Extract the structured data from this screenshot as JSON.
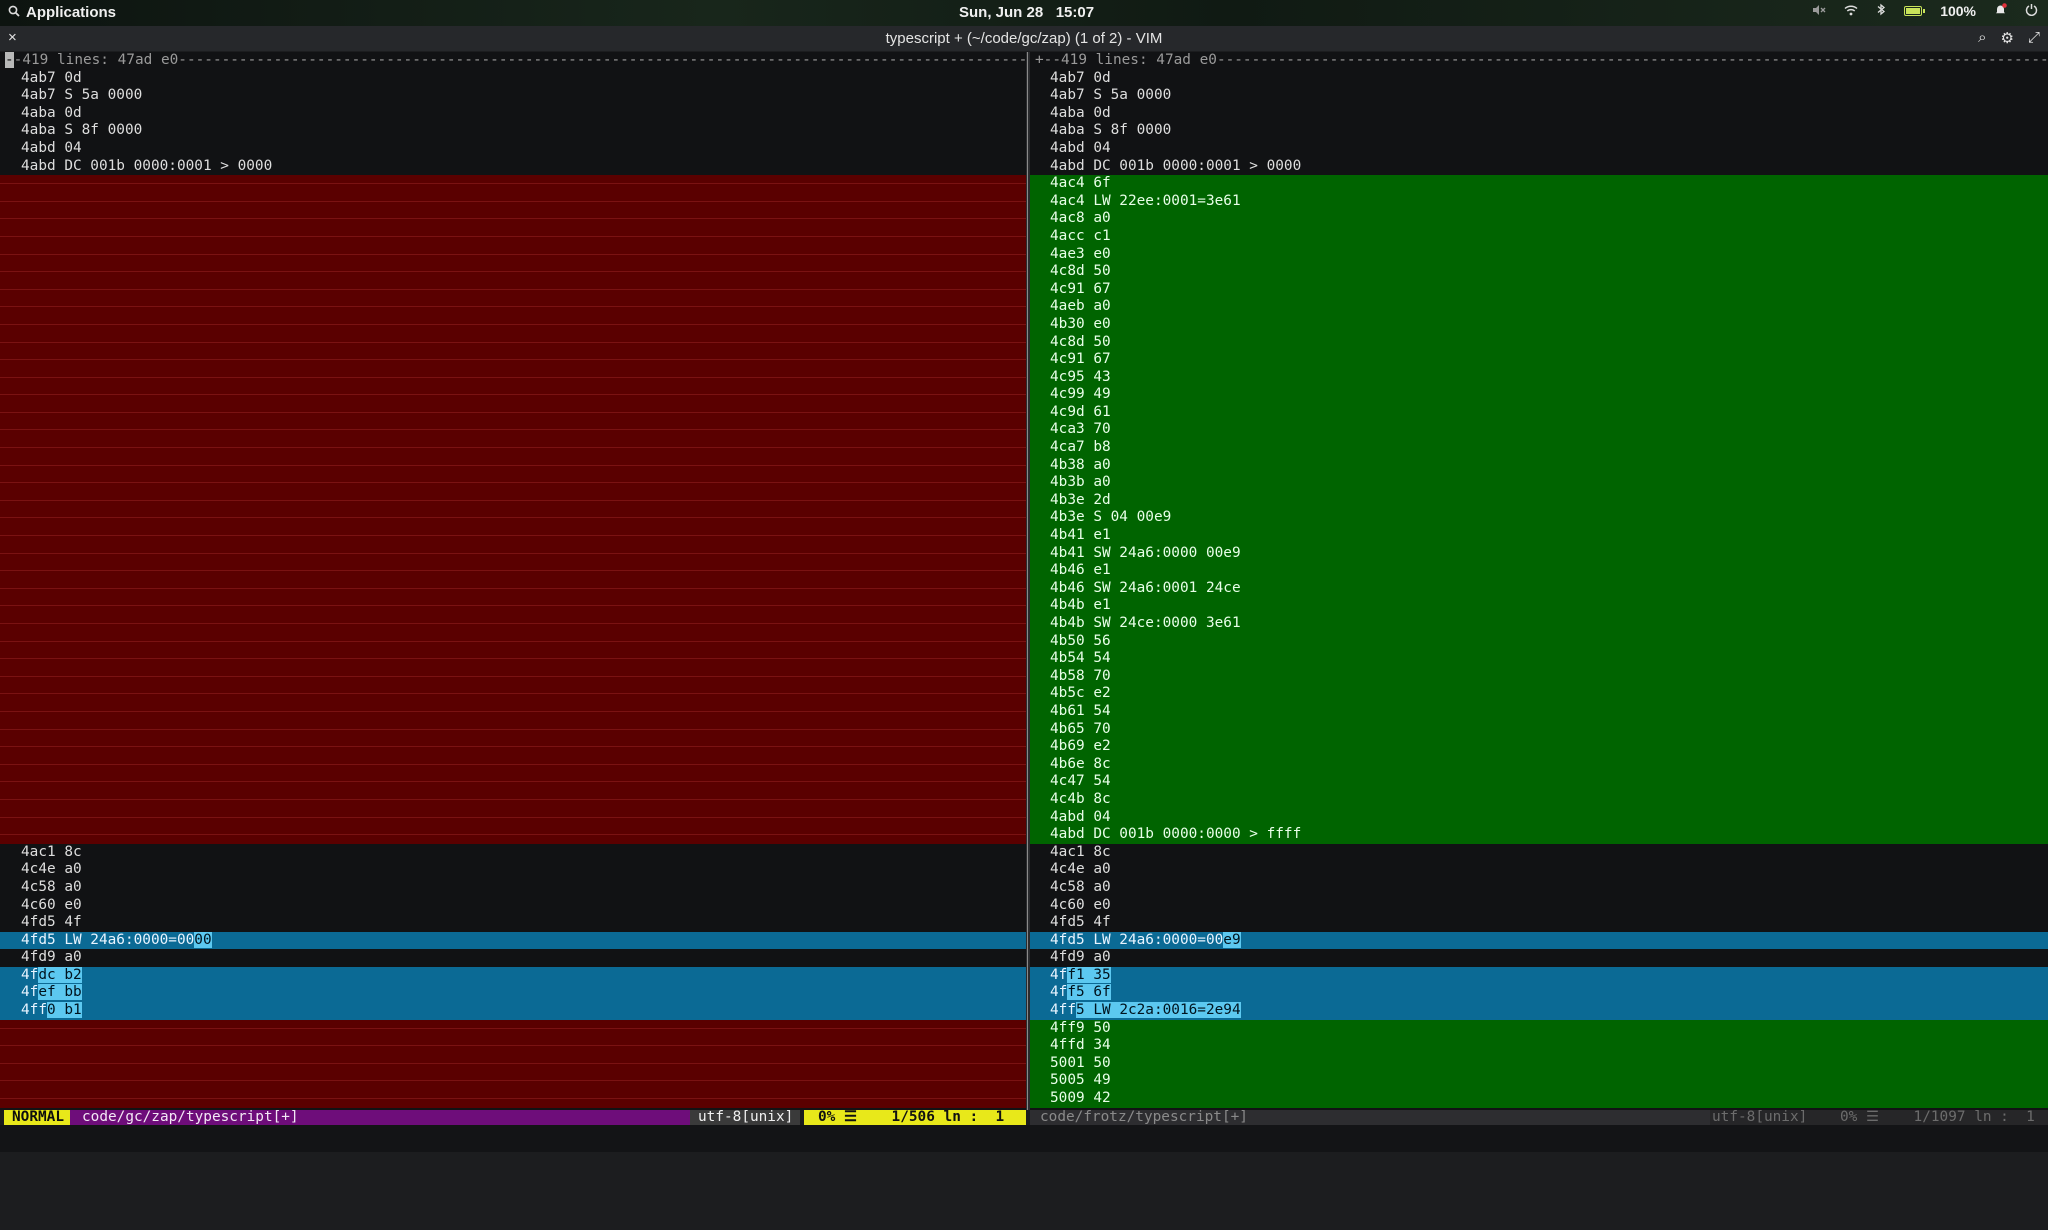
{
  "topbar": {
    "applications_label": "Applications",
    "date": "Sun, Jun 28",
    "time": "15:07",
    "battery_percent": "100%",
    "icons": [
      "search-icon",
      "speaker-muted-icon",
      "wifi-icon",
      "bluetooth-icon",
      "battery-icon",
      "notification-icon",
      "power-icon"
    ]
  },
  "window": {
    "title": "typescript + (~/code/gc/zap) (1 of 2) - VIM",
    "close_glyph": "×",
    "search_glyph": "⌕",
    "settings_glyph": "⚙",
    "expand_glyph": "⤢"
  },
  "left_pane": {
    "fold": "--419 lines: 47ad e0----------------------------------------------------------------------------------------------------------",
    "lines_top": [
      "4ab7 0d",
      "4ab7 S 5a 0000",
      "4aba 0d",
      "4aba S 8f 0000",
      "4abd 04",
      "4abd DC 001b 0000:0001 > 0000"
    ],
    "filler_count": 38,
    "lines_mid": [
      "4ac1 8c",
      "4c4e a0",
      "4c58 a0",
      "4c60 e0",
      "4fd5 4f"
    ],
    "changed_1": {
      "pre": "4fd5 LW 24a6:0000=00",
      "hl": "00"
    },
    "line_after": "4fd9 a0",
    "changed_block": [
      {
        "pre": "4f",
        "hl": "dc b2"
      },
      {
        "pre": "4f",
        "hl": "ef bb"
      },
      {
        "pre": "4ff",
        "hl": "0 b1"
      }
    ],
    "filler_bottom_count": 5
  },
  "right_pane": {
    "fold": "+--419 lines: 47ad e0---------------------------------------------------------------------------------------------------------",
    "lines_top": [
      "4ab7 0d",
      "4ab7 S 5a 0000",
      "4aba 0d",
      "4aba S 8f 0000",
      "4abd 04",
      "4abd DC 001b 0000:0001 > 0000"
    ],
    "added": [
      "4ac4 6f",
      "4ac4 LW 22ee:0001=3e61",
      "4ac8 a0",
      "4acc c1",
      "4ae3 e0",
      "4c8d 50",
      "4c91 67",
      "4aeb a0",
      "4b30 e0",
      "4c8d 50",
      "4c91 67",
      "4c95 43",
      "4c99 49",
      "4c9d 61",
      "4ca3 70",
      "4ca7 b8",
      "4b38 a0",
      "4b3b a0",
      "4b3e 2d",
      "4b3e S 04 00e9",
      "4b41 e1",
      "4b41 SW 24a6:0000 00e9",
      "4b46 e1",
      "4b46 SW 24a6:0001 24ce",
      "4b4b e1",
      "4b4b SW 24ce:0000 3e61",
      "4b50 56",
      "4b54 54",
      "4b58 70",
      "4b5c e2",
      "4b61 54",
      "4b65 70",
      "4b69 e2",
      "4b6e 8c",
      "4c47 54",
      "4c4b 8c",
      "4abd 04",
      "4abd DC 001b 0000:0000 > ffff"
    ],
    "lines_mid": [
      "4ac1 8c",
      "4c4e a0",
      "4c58 a0",
      "4c60 e0",
      "4fd5 4f"
    ],
    "changed_1": {
      "pre": "4fd5 LW 24a6:0000=00",
      "hl": "e9"
    },
    "line_after": "4fd9 a0",
    "changed_block": [
      {
        "pre": "4f",
        "hl": "f1 35"
      },
      {
        "pre": "4f",
        "hl": "f5 6f"
      },
      {
        "pre": "4ff",
        "hl": "5 LW 2c2a:0016=2e94"
      }
    ],
    "added_bottom": [
      "4ff9 50",
      "4ffd 34",
      "5001 50",
      "5005 49",
      "5009 42"
    ]
  },
  "statusbar": {
    "mode": "NORMAL",
    "file": "code/gc/zap/typescript[+]",
    "encoding": "utf-8[unix]",
    "position": "0% ☰    1/506 ln :  1",
    "right_file": "code/frotz/typescript[+]",
    "right_encoding": "utf-8[unix]",
    "right_position": "0% ☰    1/1097 ln :  1"
  },
  "colors": {
    "deleted": "#5a0000",
    "added": "#006400",
    "changed": "#0b6a95",
    "changed_text": "#5cc8f0",
    "mode_bg": "#e8e81a",
    "file_bg": "#6e0d7a"
  }
}
